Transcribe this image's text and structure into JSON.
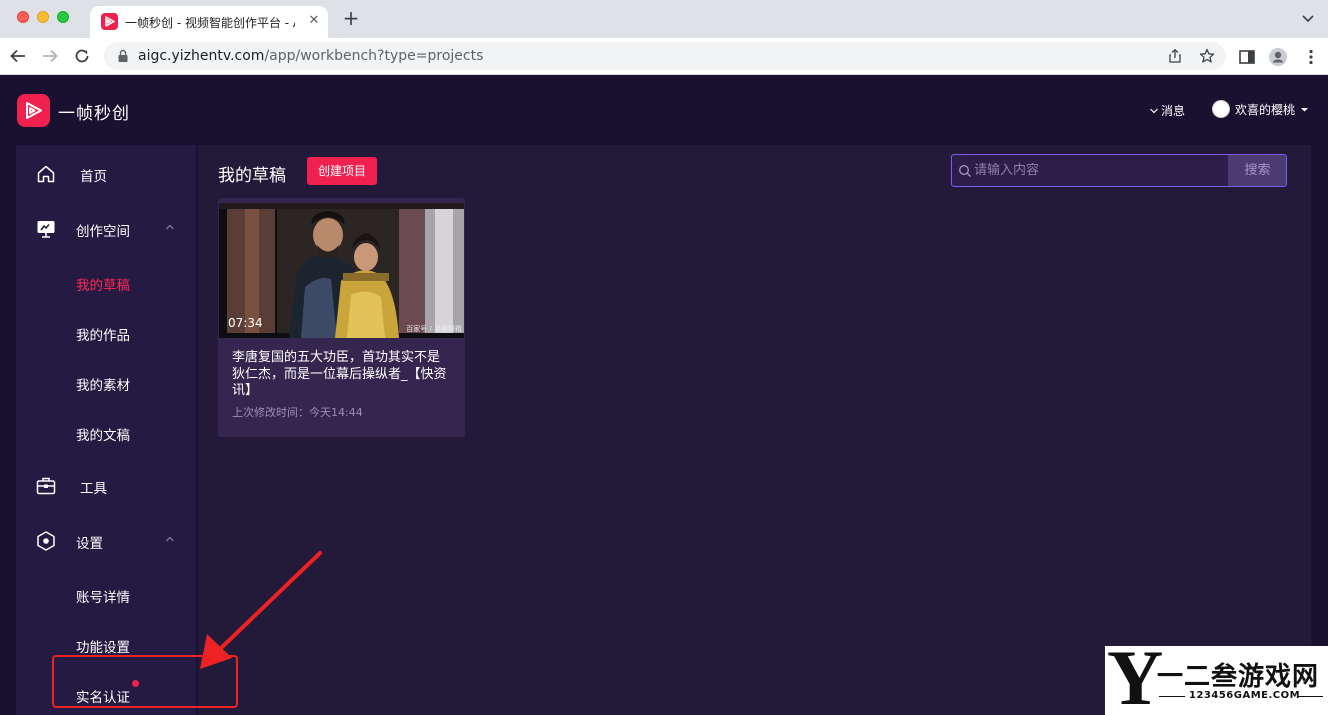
{
  "browser": {
    "tab_title": "一帧秒创 - 视频智能创作平台 - A",
    "url_host": "aigc.yizhentv.com",
    "url_path": "/app/workbench?type=projects"
  },
  "header": {
    "logo_text": "一帧秒创",
    "messages_label": "消息",
    "user_name": "欢喜的樱桃"
  },
  "sidebar": {
    "home": "首页",
    "creation_space": "创作空间",
    "my_drafts": "我的草稿",
    "my_works": "我的作品",
    "my_materials": "我的素材",
    "my_scripts": "我的文稿",
    "tools": "工具",
    "settings": "设置",
    "account_details": "账号详情",
    "feature_settings": "功能设置",
    "real_name_auth": "实名认证"
  },
  "main": {
    "title": "我的草稿",
    "create_button": "创建项目",
    "search_placeholder": "请输入内容",
    "search_button": "搜索"
  },
  "card": {
    "duration": "07:34",
    "title": "李唐复国的五大功臣，首功其实不是狄仁杰，而是一位幕后操纵者_【快资讯】",
    "modified": "上次修改时间：今天14:44",
    "thumb_caption": "百家号 / 寻根拜祖"
  },
  "watermark": {
    "letter": "Y",
    "brand": "一二叁游戏网",
    "url": "123456GAME.COM"
  },
  "colors": {
    "accent": "#f0214e",
    "page_bg": "#1a1030",
    "sidebar_bg": "#241a42",
    "main_bg": "#231939",
    "card_bg": "#35264f",
    "annotation": "#ec2224"
  }
}
